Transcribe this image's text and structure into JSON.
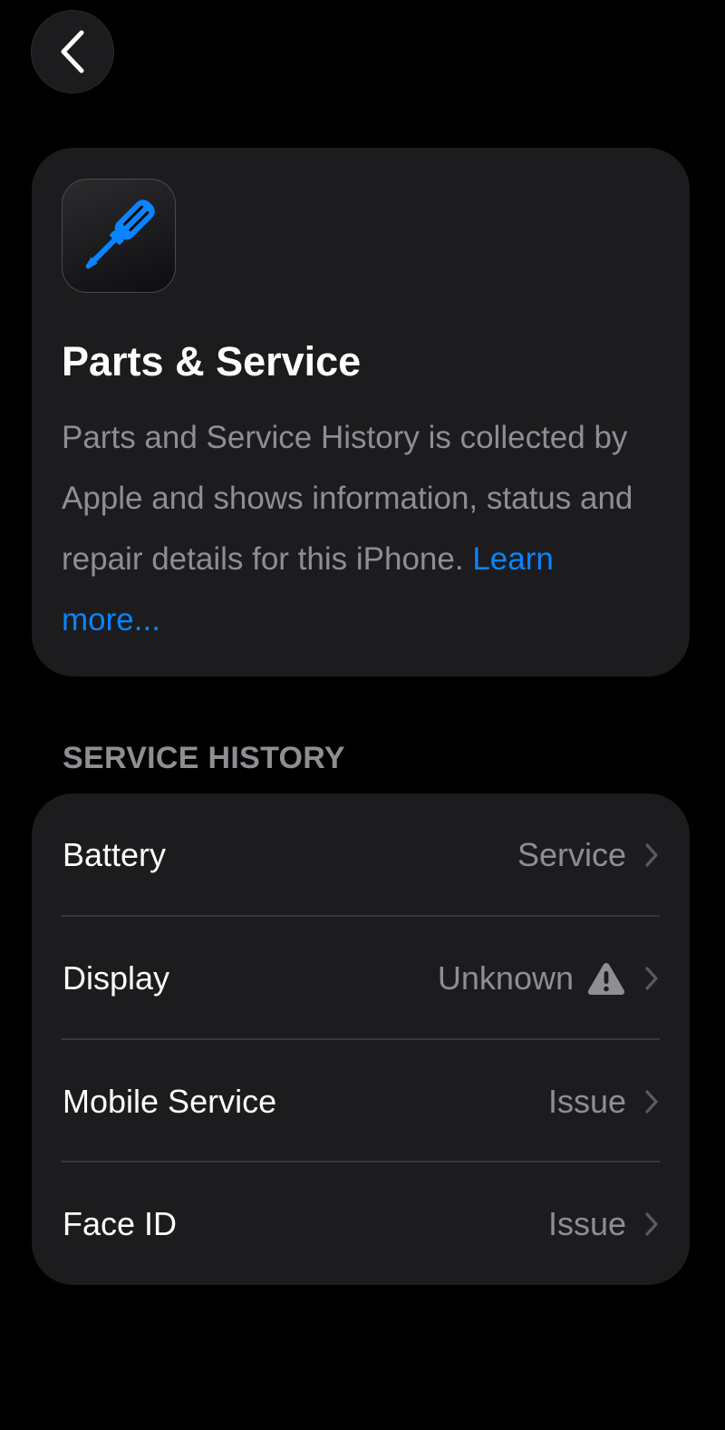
{
  "nav": {
    "back_icon": "chevron-left-icon"
  },
  "info_card": {
    "icon": "screwdriver-icon",
    "icon_color": "#0a84ff",
    "title": "Parts & Service",
    "description": "Parts and Service History is collected by Apple and shows information, status and repair details for this iPhone.",
    "learn_more": "Learn more..."
  },
  "service_history": {
    "header": "SERVICE HISTORY",
    "items": [
      {
        "label": "Battery",
        "value": "Service",
        "icon": ""
      },
      {
        "label": "Display",
        "value": "Unknown",
        "icon": "warning-icon"
      },
      {
        "label": "Mobile Service",
        "value": "Issue",
        "icon": ""
      },
      {
        "label": "Face ID",
        "value": "Issue",
        "icon": ""
      }
    ]
  },
  "colors": {
    "background": "#000000",
    "card": "#1c1c1e",
    "secondary_text": "#8e8e93",
    "link": "#0a84ff",
    "separator": "#38383a"
  }
}
